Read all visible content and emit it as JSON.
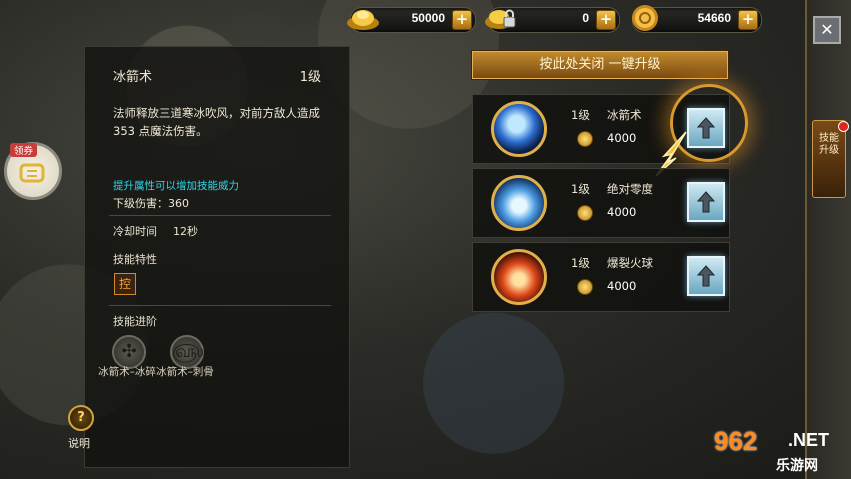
{
  "currencies": [
    {
      "icon": "gold-ingot-icon",
      "value": "50000"
    },
    {
      "icon": "locked-gold-icon",
      "value": "0"
    },
    {
      "icon": "gold-coin-icon",
      "value": "54660"
    }
  ],
  "skill_detail": {
    "name": "冰箭术",
    "level": "1级",
    "description": "法师释放三道寒冰吹风，对前方敌人造成 353 点魔法伤害。",
    "hint": "提升属性可以增加技能威力",
    "next_damage": "下级伤害：360",
    "cooldown_label": "冷却时间",
    "cooldown_value": "12秒",
    "traits_label": "技能特性",
    "trait_badge": "控",
    "advance_label": "技能进阶",
    "advances": [
      "冰箭术–冰碎",
      "冰箭术–刺骨"
    ]
  },
  "coupon": {
    "tag": "领券"
  },
  "help": {
    "icon": "?",
    "label": "说明"
  },
  "one_key_button": "按此处关闭 一键升级",
  "skills": [
    {
      "level": "1级",
      "name": "冰箭术",
      "cost": "4000",
      "icon": "ice-arrow-icon"
    },
    {
      "level": "1级",
      "name": "绝对零度",
      "cost": "4000",
      "icon": "absolute-zero-icon"
    },
    {
      "level": "1级",
      "name": "爆裂火球",
      "cost": "4000",
      "icon": "fireball-icon"
    }
  ],
  "side_tab": "技能升级",
  "close_icon": "✕",
  "watermark": {
    "number": "962",
    "net": ".NET",
    "sub": "乐游网"
  }
}
